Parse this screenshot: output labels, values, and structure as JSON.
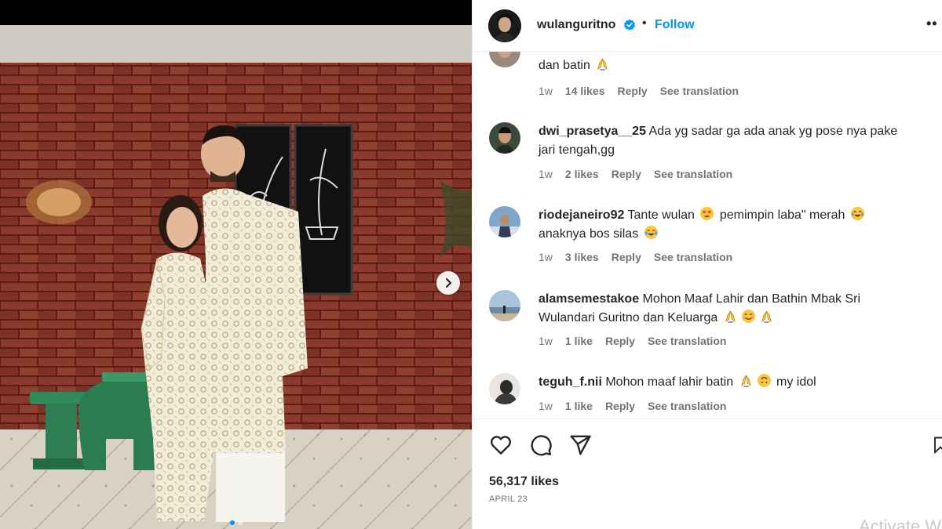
{
  "post": {
    "username": "wulanguritno",
    "bullet": "•",
    "follow_label": "Follow",
    "more_label": "••",
    "likes_total": "56,317 likes",
    "date": "APRIL 23",
    "carousel": {
      "dot_count": 2,
      "active_dot": 0
    }
  },
  "icons": {
    "verified": "verified-badge-icon",
    "next": "chevron-right-icon",
    "like": "heart-icon",
    "comment": "comment-bubble-icon",
    "share": "paper-plane-icon",
    "save": "bookmark-icon"
  },
  "colors": {
    "accent": "#0095f6",
    "text": "#262626",
    "muted": "#737373",
    "divider": "#efefef"
  },
  "comments": [
    {
      "username": "",
      "text": "dan batin",
      "emojis": [
        "folded-hands"
      ],
      "time": "1w",
      "likes": "14 likes",
      "reply": "Reply",
      "translation": "See translation"
    },
    {
      "username": "dwi_prasetya__25",
      "text": "Ada yg sadar ga ada anak yg pose nya pake jari tengah,gg",
      "emojis": [],
      "time": "1w",
      "likes": "2 likes",
      "reply": "Reply",
      "translation": "See translation"
    },
    {
      "username": "riodejaneiro92",
      "text_parts": [
        "Tante wulan",
        "pemimpin laba\" merah",
        "anaknya bos silas"
      ],
      "emojis": [
        "star-struck",
        "tears-of-joy",
        "tears-of-joy"
      ],
      "time": "1w",
      "likes": "3 likes",
      "reply": "Reply",
      "translation": "See translation"
    },
    {
      "username": "alamsemestakoe",
      "text": "Mohon Maaf Lahir dan Bathin Mbak Sri Wulandari Guritno dan Keluarga",
      "emojis": [
        "folded-hands",
        "smiling-face",
        "folded-hands"
      ],
      "time": "1w",
      "likes": "1 like",
      "reply": "Reply",
      "translation": "See translation"
    },
    {
      "username": "teguh_f.nii",
      "text": "Mohon maaf lahir batin",
      "text_after": "my idol",
      "emojis": [
        "folded-hands",
        "upside-down-face"
      ],
      "time": "1w",
      "likes": "1 like",
      "reply": "Reply",
      "translation": "See translation"
    }
  ],
  "watermark": "Activate W"
}
